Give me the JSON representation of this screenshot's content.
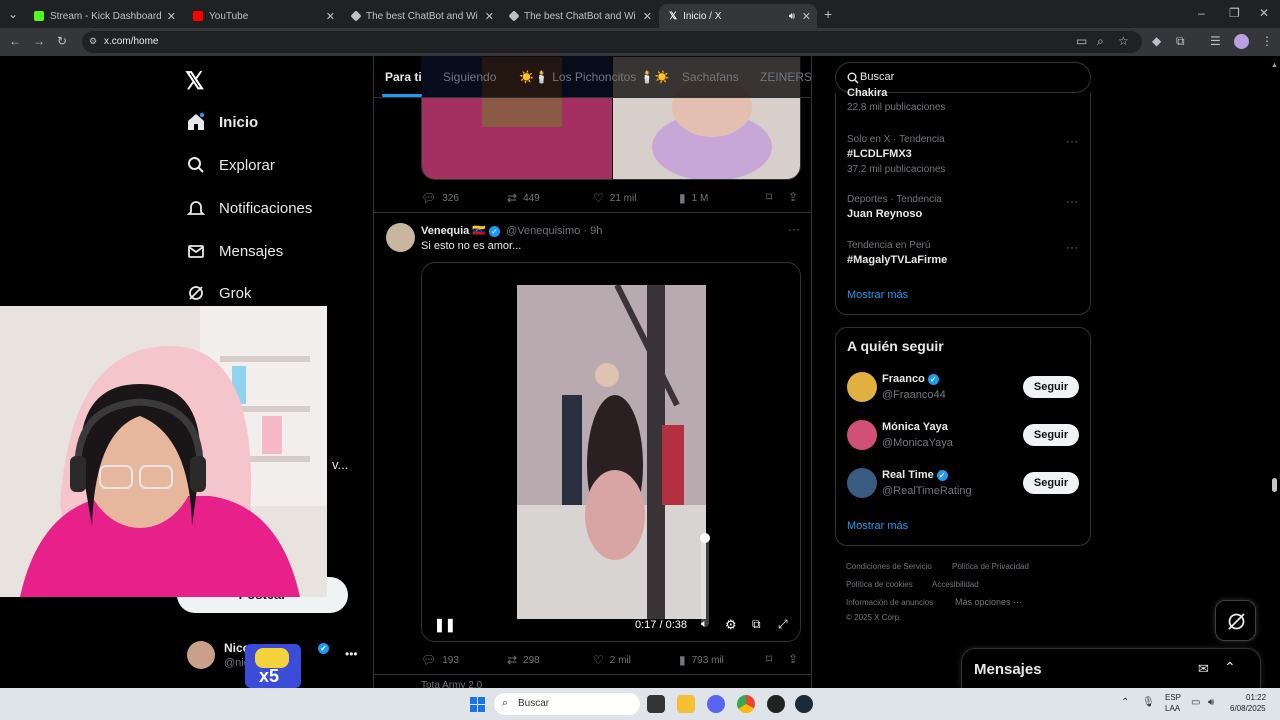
{
  "browser": {
    "tabs": [
      {
        "title": "Stream - Kick Dashboard",
        "color": "#53fc18"
      },
      {
        "title": "YouTube",
        "color": "#ff0000"
      },
      {
        "title": "The best ChatBot and Widgets",
        "color": "#bdc1c6"
      },
      {
        "title": "The best ChatBot and Widgets",
        "color": "#bdc1c6"
      },
      {
        "title": "Inicio / X",
        "color": "#ffffff"
      }
    ],
    "url": "x.com/home"
  },
  "nav": {
    "items": [
      {
        "label": "Inicio",
        "icon": "home-icon"
      },
      {
        "label": "Explorar",
        "icon": "search-icon"
      },
      {
        "label": "Notificaciones",
        "icon": "bell-icon"
      },
      {
        "label": "Mensajes",
        "icon": "mail-icon"
      },
      {
        "label": "Grok",
        "icon": "grok-icon"
      }
    ],
    "post_label": "Postear",
    "account_name": "Nico",
    "account_handle": "@nic",
    "overlay_text": "x5"
  },
  "feed": {
    "tabs": [
      "Para ti",
      "Siguiendo",
      "☀️🕯️ Los Pichoncitos 🕯️☀️",
      "Sachafans",
      "ZEINERS"
    ],
    "post1_actions": {
      "replies": "326",
      "reposts": "449",
      "likes": "21 mil",
      "views": "1 M"
    },
    "post2": {
      "author": "Venequia 🇻🇪",
      "handle": "@Venequisimo",
      "time": "9h",
      "text": "Si esto no es amor...",
      "video_time": "0:17 / 0:38",
      "video_progress": 0.447
    },
    "post2_actions": {
      "replies": "193",
      "reposts": "298",
      "likes": "2 mil",
      "views": "793 mil"
    },
    "post3_author": "Tota Army 2.0"
  },
  "right": {
    "search_placeholder": "Buscar",
    "trends": [
      {
        "meta": "",
        "name": "Chakira",
        "count": "22,8 mil publicaciones"
      },
      {
        "meta": "Solo en X · Tendencia",
        "name": "#LCDLFMX3",
        "count": "37,2 mil publicaciones"
      },
      {
        "meta": "Deportes · Tendencia",
        "name": "Juan Reynoso",
        "count": ""
      },
      {
        "meta": "Tendencia en Perú",
        "name": "#MagalyTVLaFirme",
        "count": ""
      }
    ],
    "show_more": "Mostrar más",
    "who_to_follow_title": "A quién seguir",
    "follow": [
      {
        "name": "Fraanco",
        "handle": "@Fraanco44",
        "button": "Seguir"
      },
      {
        "name": "Mónica Yaya",
        "handle": "@MonicaYaya",
        "button": "Seguir"
      },
      {
        "name": "Real Time",
        "handle": "@RealTimeRating",
        "button": "Seguir"
      }
    ],
    "footer": {
      "terms": "Condiciones de Servicio",
      "privacy": "Política de Privacidad",
      "cookies": "Política de cookies",
      "accessibility": "Accesibilidad",
      "ads": "Información de anuncios",
      "more": "Más opciones ···",
      "copyright": "© 2025 X Corp."
    },
    "messages_label": "Mensajes"
  },
  "taskbar": {
    "search_placeholder": "Buscar",
    "lang": "ESP",
    "lang2": "LAA",
    "time": "01:22",
    "date": "6/08/2025"
  }
}
